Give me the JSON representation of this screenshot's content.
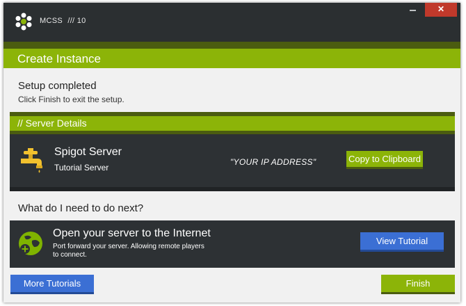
{
  "window": {
    "title": "MCSS",
    "version": "/// 10",
    "close_glyph": "✕"
  },
  "header": {
    "title": "Create Instance"
  },
  "setup": {
    "title": "Setup completed",
    "subtitle": "Click Finish to exit the setup."
  },
  "server_details": {
    "section_title": "// Server Details",
    "server_name": "Spigot Server",
    "server_type": "Tutorial Server",
    "ip": "\"YOUR IP ADDRESS\"",
    "copy_button": "Copy to Clipboard"
  },
  "next_steps": {
    "title": "What do I need to do next?",
    "card_title": "Open your server to the Internet",
    "card_description": "Port forward your server. Allowing remote players to connect.",
    "view_button": "View Tutorial"
  },
  "footer": {
    "more_button": "More Tutorials",
    "finish_button": "Finish"
  },
  "colors": {
    "accent_green": "#8cb408",
    "dark_green": "#4b5c10",
    "panel_dark": "#2d3134",
    "button_blue": "#3b6fd4",
    "close_red": "#c0392b"
  },
  "icons": {
    "app_logo": "flower-logo-icon",
    "server": "water-tap-icon",
    "internet": "globe-plus-icon"
  }
}
